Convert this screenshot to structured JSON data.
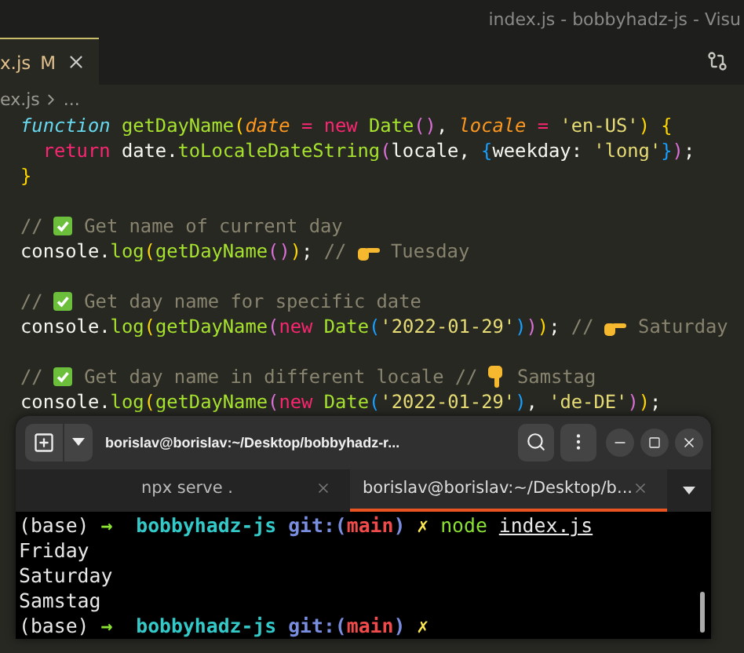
{
  "window": {
    "title": "index.js - bobbyhadz-js - Visu"
  },
  "editor_tabs": [
    {
      "label": "x.js",
      "status": "M",
      "selected": true
    }
  ],
  "breadcrumb": [
    "ex.js",
    "..."
  ],
  "code_blocks": [
    {
      "lines": [
        [
          {
            "kind": "kw",
            "text": "function"
          },
          {
            "kind": "fn",
            "text": " getDayName"
          },
          {
            "kind": "b1",
            "text": "("
          },
          {
            "kind": "param",
            "text": "date"
          },
          {
            "kind": "op",
            "text": " = "
          },
          {
            "kind": "kw2",
            "text": "new"
          },
          {
            "kind": "fn",
            "text": " Date"
          },
          {
            "kind": "b2",
            "text": "()"
          },
          {
            "kind": "plain",
            "text": ", "
          },
          {
            "kind": "param",
            "text": "locale"
          },
          {
            "kind": "op",
            "text": " = "
          },
          {
            "kind": "str",
            "text": "'en-US'"
          },
          {
            "kind": "b1",
            "text": ")"
          },
          {
            "kind": "b1",
            "text": " {"
          }
        ],
        [
          {
            "kind": "kw2",
            "text": "  return"
          },
          {
            "kind": "plain",
            "text": " date."
          },
          {
            "kind": "fn",
            "text": "toLocaleDateString"
          },
          {
            "kind": "b2",
            "text": "("
          },
          {
            "kind": "plain",
            "text": "locale, "
          },
          {
            "kind": "b3",
            "text": "{"
          },
          {
            "kind": "plain",
            "text": "weekday: "
          },
          {
            "kind": "str",
            "text": "'long'"
          },
          {
            "kind": "b3",
            "text": "}"
          },
          {
            "kind": "b2",
            "text": ")"
          },
          {
            "kind": "plain",
            "text": ";"
          }
        ],
        [
          {
            "kind": "b1",
            "text": "}"
          }
        ]
      ]
    },
    {
      "lines": [
        [
          {
            "kind": "comment",
            "text": "// "
          },
          {
            "kind": "check-emoji"
          },
          {
            "kind": "comment",
            "text": " Get name of current day"
          }
        ],
        [
          {
            "kind": "plain",
            "text": "console."
          },
          {
            "kind": "fn",
            "text": "log"
          },
          {
            "kind": "b1",
            "text": "("
          },
          {
            "kind": "fn",
            "text": "getDayName"
          },
          {
            "kind": "b2",
            "text": "()"
          },
          {
            "kind": "b1",
            "text": ")"
          },
          {
            "kind": "plain",
            "text": ";"
          },
          {
            "kind": "comment",
            "text": " // "
          },
          {
            "kind": "point-right-emoji"
          },
          {
            "kind": "comment",
            "text": " Tuesday"
          }
        ]
      ]
    },
    {
      "lines": [
        [
          {
            "kind": "comment",
            "text": "// "
          },
          {
            "kind": "check-emoji"
          },
          {
            "kind": "comment",
            "text": " Get day name for specific date"
          }
        ],
        [
          {
            "kind": "plain",
            "text": "console."
          },
          {
            "kind": "fn",
            "text": "log"
          },
          {
            "kind": "b1",
            "text": "("
          },
          {
            "kind": "fn",
            "text": "getDayName"
          },
          {
            "kind": "b2",
            "text": "("
          },
          {
            "kind": "kw2",
            "text": "new"
          },
          {
            "kind": "fn",
            "text": " Date"
          },
          {
            "kind": "b3",
            "text": "("
          },
          {
            "kind": "str",
            "text": "'2022-01-29'"
          },
          {
            "kind": "b3",
            "text": ")"
          },
          {
            "kind": "b2",
            "text": ")"
          },
          {
            "kind": "b1",
            "text": ")"
          },
          {
            "kind": "plain",
            "text": ";"
          },
          {
            "kind": "comment",
            "text": " // "
          },
          {
            "kind": "point-right-emoji"
          },
          {
            "kind": "comment",
            "text": " Saturday"
          }
        ]
      ]
    },
    {
      "lines": [
        [
          {
            "kind": "comment",
            "text": "// "
          },
          {
            "kind": "check-emoji"
          },
          {
            "kind": "comment",
            "text": " Get day name in different locale // "
          },
          {
            "kind": "point-down-emoji"
          },
          {
            "kind": "comment",
            "text": " Samstag"
          }
        ],
        [
          {
            "kind": "plain",
            "text": "console."
          },
          {
            "kind": "fn",
            "text": "log"
          },
          {
            "kind": "b1",
            "text": "("
          },
          {
            "kind": "fn",
            "text": "getDayName"
          },
          {
            "kind": "b2",
            "text": "("
          },
          {
            "kind": "kw2",
            "text": "new"
          },
          {
            "kind": "fn",
            "text": " Date"
          },
          {
            "kind": "b3",
            "text": "("
          },
          {
            "kind": "str",
            "text": "'2022-01-29'"
          },
          {
            "kind": "b3",
            "text": ")"
          },
          {
            "kind": "plain",
            "text": ", "
          },
          {
            "kind": "str",
            "text": "'de-DE'"
          },
          {
            "kind": "b2",
            "text": ")"
          },
          {
            "kind": "b1",
            "text": ")"
          },
          {
            "kind": "plain",
            "text": ";"
          }
        ]
      ]
    }
  ],
  "terminal": {
    "title": "borislav@borislav:~/Desktop/bobbyhadz-r...",
    "tabs": [
      {
        "label": "npx serve .",
        "selected": false
      },
      {
        "label": "borislav@borislav:~/Desktop/b...",
        "selected": true
      }
    ],
    "lines": [
      [
        {
          "kind": "plain",
          "text": "(base) "
        },
        {
          "kind": "arrow",
          "text": "→"
        },
        {
          "kind": "dir",
          "text": "  bobbyhadz-js"
        },
        {
          "kind": "git",
          "text": " git:("
        },
        {
          "kind": "branch",
          "text": "main"
        },
        {
          "kind": "git",
          "text": ")"
        },
        {
          "kind": "dirty",
          "text": " ✗"
        },
        {
          "kind": "cmd",
          "text": " node "
        },
        {
          "kind": "path",
          "text": "index.js"
        }
      ],
      [
        {
          "kind": "plain",
          "text": "Friday"
        }
      ],
      [
        {
          "kind": "plain",
          "text": "Saturday"
        }
      ],
      [
        {
          "kind": "plain",
          "text": "Samstag"
        }
      ],
      [
        {
          "kind": "plain",
          "text": "(base) "
        },
        {
          "kind": "arrow",
          "text": "→"
        },
        {
          "kind": "dir",
          "text": "  bobbyhadz-js"
        },
        {
          "kind": "git",
          "text": " git:("
        },
        {
          "kind": "branch",
          "text": "main"
        },
        {
          "kind": "git",
          "text": ")"
        },
        {
          "kind": "dirty",
          "text": " ✗"
        }
      ]
    ]
  }
}
